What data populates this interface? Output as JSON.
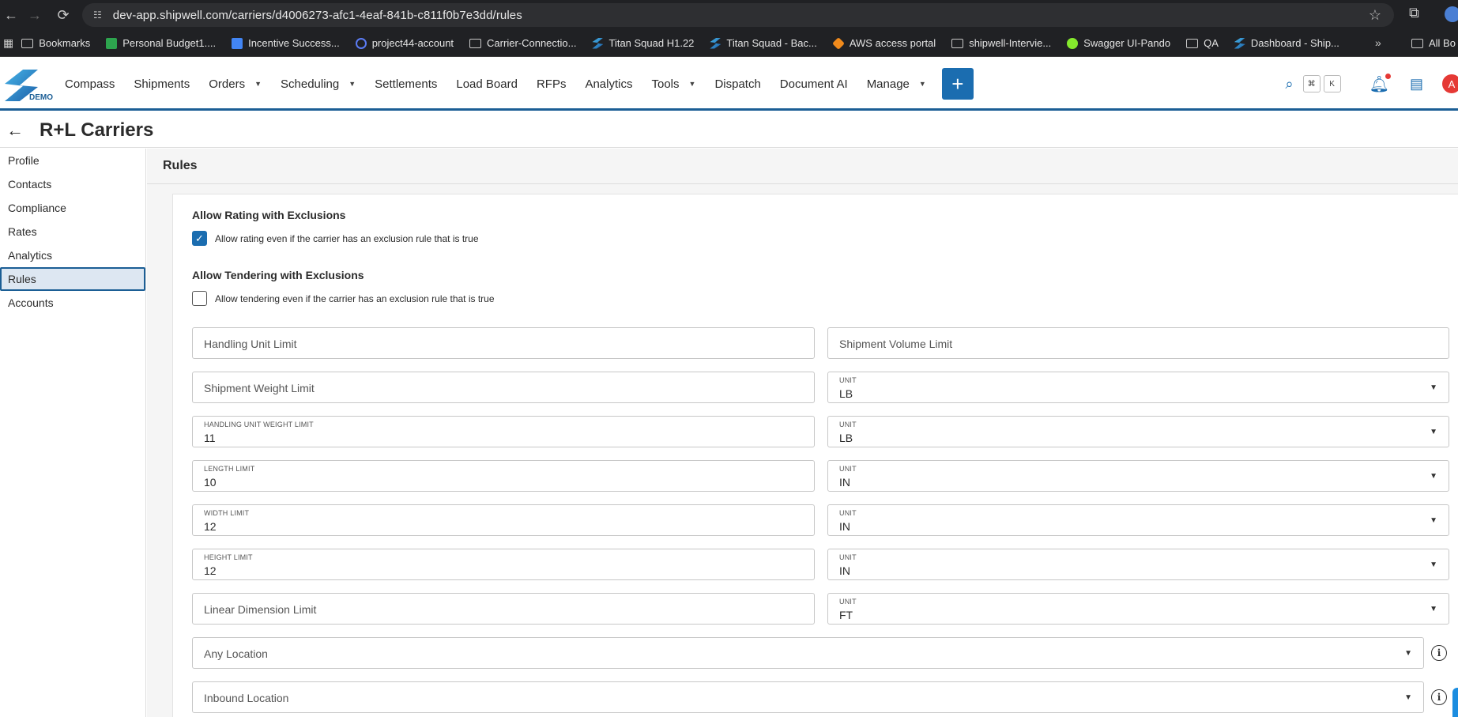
{
  "browser": {
    "url": "dev-app.shipwell.com/carriers/d4006273-afc1-4eaf-841b-c811f0b7e3dd/rules",
    "bookmarks": [
      {
        "label": "Bookmarks",
        "icon": "folder-icon"
      },
      {
        "label": "Personal Budget1....",
        "icon": "sheets-icon"
      },
      {
        "label": "Incentive Success...",
        "icon": "docs-icon"
      },
      {
        "label": "project44-account",
        "icon": "hex-icon"
      },
      {
        "label": "Carrier-Connectio...",
        "icon": "folder-icon"
      },
      {
        "label": "Titan Squad H1.22",
        "icon": "shipwell-icon"
      },
      {
        "label": "Titan Squad - Bac...",
        "icon": "shipwell-icon"
      },
      {
        "label": "AWS access portal",
        "icon": "aws-icon"
      },
      {
        "label": "shipwell-Intervie...",
        "icon": "folder-icon"
      },
      {
        "label": "Swagger UI-Pando",
        "icon": "swagger-icon"
      },
      {
        "label": "QA",
        "icon": "folder-icon"
      },
      {
        "label": "Dashboard - Ship...",
        "icon": "shipwell-icon"
      }
    ],
    "more": "»",
    "all_bookmarks": "All Bo"
  },
  "header": {
    "logo_badge": "DEMO",
    "nav": [
      {
        "label": "Compass",
        "dropdown": false
      },
      {
        "label": "Shipments",
        "dropdown": false
      },
      {
        "label": "Orders",
        "dropdown": true
      },
      {
        "label": "Scheduling",
        "dropdown": true
      },
      {
        "label": "Settlements",
        "dropdown": false
      },
      {
        "label": "Load Board",
        "dropdown": false
      },
      {
        "label": "RFPs",
        "dropdown": false
      },
      {
        "label": "Analytics",
        "dropdown": false
      },
      {
        "label": "Tools",
        "dropdown": true
      },
      {
        "label": "Dispatch",
        "dropdown": false
      },
      {
        "label": "Document AI",
        "dropdown": false
      },
      {
        "label": "Manage",
        "dropdown": true
      }
    ],
    "shortcut_keys": [
      "⌘",
      "K"
    ],
    "avatar_initial": "A",
    "accent_color": "#1b6db0"
  },
  "page": {
    "title": "R+L Carriers"
  },
  "sidebar": {
    "items": [
      {
        "label": "Profile",
        "active": false
      },
      {
        "label": "Contacts",
        "active": false
      },
      {
        "label": "Compliance",
        "active": false
      },
      {
        "label": "Rates",
        "active": false
      },
      {
        "label": "Analytics",
        "active": false
      },
      {
        "label": "Rules",
        "active": true
      },
      {
        "label": "Accounts",
        "active": false
      }
    ]
  },
  "rules": {
    "heading": "Rules",
    "rating": {
      "title": "Allow Rating with Exclusions",
      "label": "Allow rating even if the carrier has an exclusion rule that is true",
      "checked": true
    },
    "tendering": {
      "title": "Allow Tendering with Exclusions",
      "label": "Allow tendering even if the carrier has an exclusion rule that is true",
      "checked": false
    },
    "fields": {
      "handling_unit_limit": {
        "placeholder": "Handling Unit Limit"
      },
      "shipment_volume_limit": {
        "placeholder": "Shipment Volume Limit"
      },
      "shipment_weight_limit": {
        "placeholder": "Shipment Weight Limit"
      },
      "shipment_weight_unit": {
        "label": "UNIT",
        "value": "LB"
      },
      "hu_weight_limit": {
        "label": "HANDLING UNIT WEIGHT LIMIT",
        "value": "11"
      },
      "hu_weight_unit": {
        "label": "UNIT",
        "value": "LB"
      },
      "length_limit": {
        "label": "LENGTH LIMIT",
        "value": "10"
      },
      "length_unit": {
        "label": "UNIT",
        "value": "IN"
      },
      "width_limit": {
        "label": "WIDTH LIMIT",
        "value": "12"
      },
      "width_unit": {
        "label": "UNIT",
        "value": "IN"
      },
      "height_limit": {
        "label": "HEIGHT LIMIT",
        "value": "12"
      },
      "height_unit": {
        "label": "UNIT",
        "value": "IN"
      },
      "linear_dimension_limit": {
        "placeholder": "Linear Dimension Limit"
      },
      "linear_dimension_unit": {
        "label": "UNIT",
        "value": "FT"
      },
      "any_location": {
        "placeholder": "Any Location"
      },
      "inbound_location": {
        "placeholder": "Inbound Location"
      }
    }
  }
}
